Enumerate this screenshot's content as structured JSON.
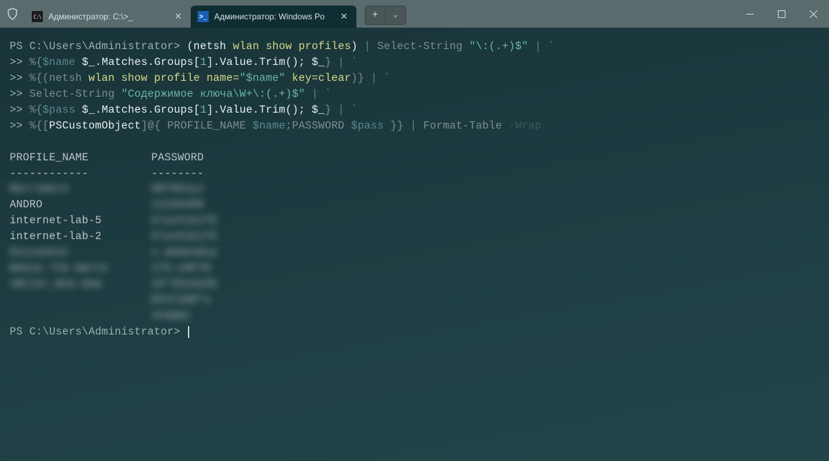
{
  "titlebar": {
    "tabs": [
      {
        "title": "Администратор: C:\\>_",
        "icon": "cmd",
        "active": false
      },
      {
        "title": "Администратор: Windows Po",
        "icon": "ps",
        "active": true
      }
    ],
    "new_tab_plus": "+",
    "new_tab_chevron": "⌄"
  },
  "terminal": {
    "line1_prompt": "PS C:\\Users\\Administrator> ",
    "line1_a": "(netsh ",
    "line1_b": "wlan show profiles",
    "line1_c": ")",
    "line1_pipe": " | ",
    "line1_d": "Select-String ",
    "line1_e": "\"\\:(.+)$\"",
    "line1_pipe2": " | ",
    "line1_tick": "`",
    "line2_cont": ">> ",
    "line2_a": "%{",
    "line2_b": "$name ",
    "line2_c": "$_",
    "line2_d": ".Matches.Groups[",
    "line2_e": "1",
    "line2_f": "].Value.Trim(); ",
    "line2_g": "$_",
    "line2_h": "} ",
    "line2_pipe": "| ",
    "line2_tick": "`",
    "line3_cont": ">> ",
    "line3_a": "%{(netsh ",
    "line3_b": "wlan show profile name=",
    "line3_c": "\"$name\"",
    "line3_d": " key=clear",
    "line3_e": ")} ",
    "line3_pipe": "| ",
    "line3_tick": "`",
    "line4_cont": ">> ",
    "line4_a": "Select-String ",
    "line4_b": "\"Содержимое ключа\\W+\\:(.+)$\"",
    "line4_pipe": " | ",
    "line4_tick": "`",
    "line5_cont": ">> ",
    "line5_a": "%{",
    "line5_b": "$pass ",
    "line5_c": "$_",
    "line5_d": ".Matches.Groups[",
    "line5_e": "1",
    "line5_f": "].Value.Trim(); ",
    "line5_g": "$_",
    "line5_h": "} ",
    "line5_pipe": "| ",
    "line5_tick": "`",
    "line6_cont": ">> ",
    "line6_a": "%{[",
    "line6_b": "PSCustomObject",
    "line6_c": "]@{ PROFILE_NAME ",
    "line6_d": "$name",
    "line6_e": ";PASSWORD ",
    "line6_f": "$pass ",
    "line6_g": "}} ",
    "line6_pipe": "| ",
    "line6_h": "Format-Table ",
    "line6_i": "-Wrap",
    "blank": "",
    "header_profile": "PROFILE_NAME",
    "header_password": "PASSWORD",
    "sep_profile": "------------",
    "sep_password": "--------",
    "rows": [
      {
        "profile": "Barrimore",
        "password": "98765xyz",
        "blur_profile": true,
        "blur_password": true
      },
      {
        "profile": "ANDRO",
        "password": "11234499",
        "blur_profile": false,
        "blur_password": true
      },
      {
        "profile": "internet-lab-5",
        "password": "kluchik175",
        "blur_profile": false,
        "blur_password": true
      },
      {
        "profile": "internet-lab-2",
        "password": "kluchik175",
        "blur_profile": false,
        "blur_password": true
      },
      {
        "profile": "Osisonest",
        "password": "x.akmendia",
        "blur_profile": true,
        "blur_password": true
      },
      {
        "profile": "Nokia 7tm marto",
        "password": "17h-cHF78",
        "blur_profile": true,
        "blur_password": true
      },
      {
        "profile": "sMiler_Nik-dom",
        "password": "15\"2514235",
        "blur_profile": true,
        "blur_password": true
      },
      {
        "profile": "",
        "password": "EFV7180\"s",
        "blur_profile": true,
        "blur_password": true
      },
      {
        "profile": "",
        "password": "tFabbt",
        "blur_profile": true,
        "blur_password": true
      }
    ],
    "final_prompt": "PS C:\\Users\\Administrator> "
  }
}
